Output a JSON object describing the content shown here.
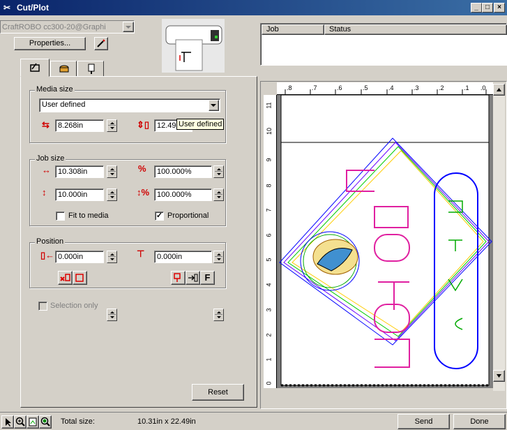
{
  "window": {
    "title": "Cut/Plot",
    "min": "_",
    "max": "□",
    "close": "×"
  },
  "device": {
    "selected": "CraftROBO cc300-20@Graphi"
  },
  "properties_button": "Properties...",
  "job_table": {
    "columns": [
      "Job",
      "Status"
    ]
  },
  "media_size": {
    "label": "Media size",
    "selected": "User defined",
    "width": "8.268in",
    "height": "12.49",
    "tooltip": "User defined"
  },
  "job_size": {
    "label": "Job size",
    "width": "10.308in",
    "width_pct": "100.000%",
    "height": "10.000in",
    "height_pct": "100.000%",
    "fit_to_media": "Fit to media",
    "proportional": "Proportional"
  },
  "position": {
    "label": "Position",
    "x": "0.000in",
    "y": "0.000in",
    "f_button": "F"
  },
  "selection_only": "Selection only",
  "reset_button": "Reset",
  "status_bar": {
    "total_size_label": "Total size:",
    "total_size_value": "10.31in x 22.49in"
  },
  "send_button": "Send",
  "done_button": "Done",
  "ruler_top": [
    ".8",
    ".7",
    ".6",
    ".5",
    ".4",
    ".3",
    ".2",
    ".1",
    ".0"
  ],
  "ruler_left": [
    "11",
    "10",
    "9",
    "8",
    "7",
    "6",
    "5",
    "4",
    "3",
    "2",
    "1",
    "0"
  ],
  "colors": {
    "title_start": "#0a246a",
    "title_end": "#3a6ea5",
    "face": "#d4d0c8"
  }
}
